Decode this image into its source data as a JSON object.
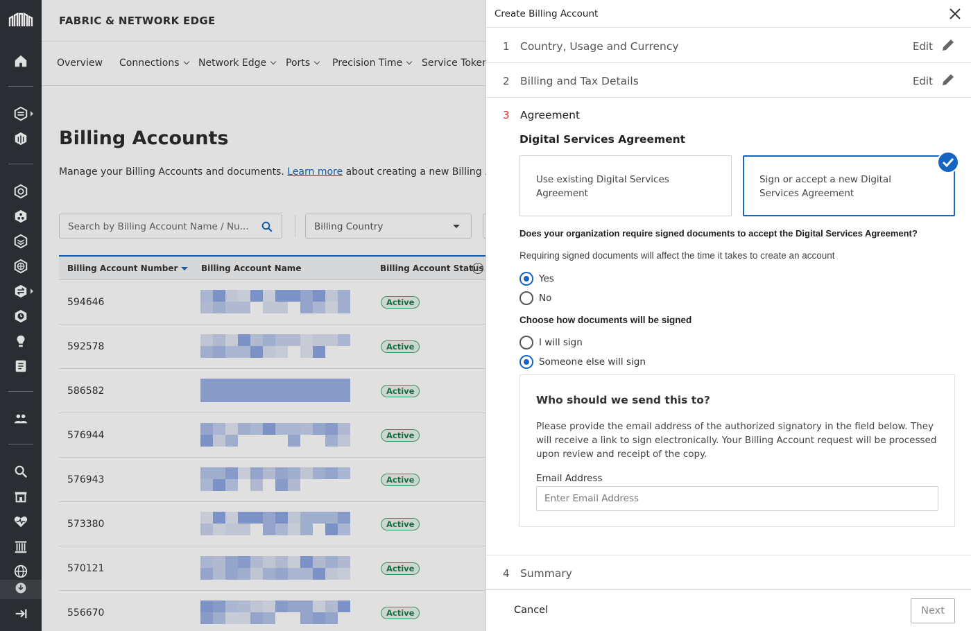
{
  "app": {
    "brand": "FABRIC & NETWORK EDGE"
  },
  "leftnav": {
    "icons": [
      "equinix-logo-icon",
      "home-icon",
      "layers-icon",
      "cube-icon",
      "network-icon",
      "share-icon",
      "stack-icon",
      "globe-grid-icon",
      "swap-icon",
      "clock-icon",
      "lightbulb-icon",
      "book-icon",
      "users-icon",
      "search-icon",
      "store-icon",
      "heartbeat-icon",
      "building-icon",
      "globe-icon",
      "download-icon",
      "logout-icon"
    ]
  },
  "subnav": {
    "items": [
      {
        "label": "Overview",
        "dropdown": false
      },
      {
        "label": "Connections",
        "dropdown": true
      },
      {
        "label": "Network Edge",
        "dropdown": true
      },
      {
        "label": "Ports",
        "dropdown": true
      },
      {
        "label": "Precision Time",
        "dropdown": true
      },
      {
        "label": "Service Tokens",
        "dropdown": false
      }
    ]
  },
  "page": {
    "title": "Billing Accounts",
    "desc_prefix": "Manage your Billing Accounts and documents.",
    "desc_link": "Learn more",
    "desc_suffix": "about creating a new Billing Account."
  },
  "filters": {
    "search_placeholder": "Search by Billing Account Name / Nu...",
    "country_placeholder": "Billing Country"
  },
  "table": {
    "headers": [
      "Billing Account Number",
      "Billing Account Name",
      "Billing Account Status"
    ],
    "rows": [
      {
        "number": "594646",
        "status": "Active"
      },
      {
        "number": "592578",
        "status": "Active"
      },
      {
        "number": "586582",
        "status": "Active"
      },
      {
        "number": "576944",
        "status": "Active"
      },
      {
        "number": "576943",
        "status": "Active"
      },
      {
        "number": "573380",
        "status": "Active"
      },
      {
        "number": "570121",
        "status": "Active"
      },
      {
        "number": "556670",
        "status": "Active"
      }
    ]
  },
  "drawer": {
    "title": "Create Billing Account",
    "steps": [
      {
        "n": "1",
        "label": "Country, Usage and Currency",
        "edit": "Edit"
      },
      {
        "n": "2",
        "label": "Billing and Tax Details",
        "edit": "Edit"
      },
      {
        "n": "3",
        "label": "Agreement"
      },
      {
        "n": "4",
        "label": "Summary"
      }
    ],
    "agreement": {
      "heading": "Digital Services Agreement",
      "option_existing": "Use existing Digital Services Agreement",
      "option_new": "Sign or accept a new Digital Services Agreement",
      "selected": "new",
      "q_signed": "Does your organization require signed documents to accept the Digital Services Agreement?",
      "q_signed_sub": "Requiring signed documents will affect the time it takes to create an account",
      "yes": "Yes",
      "no": "No",
      "signed_value": "Yes",
      "q_how": "Choose how documents will be signed",
      "i_sign": "I will sign",
      "else_sign": "Someone else will sign",
      "how_value": "Someone else will sign",
      "send_heading": "Who should we send this to?",
      "send_text": "Please provide the email address of the authorized signatory in the field below. They will receive a link to sign electronically. Your Billing Account request will be processed upon review and receipt of the copy.",
      "email_label": "Email Address",
      "email_placeholder": "Enter Email Address",
      "email_value": ""
    },
    "footer": {
      "cancel": "Cancel",
      "next": "Next"
    }
  },
  "colors": {
    "accent": "#1565c0",
    "step_active": "#d32f2f",
    "status_green": "#3aa86b",
    "nav_bg": "#2a2d31"
  }
}
